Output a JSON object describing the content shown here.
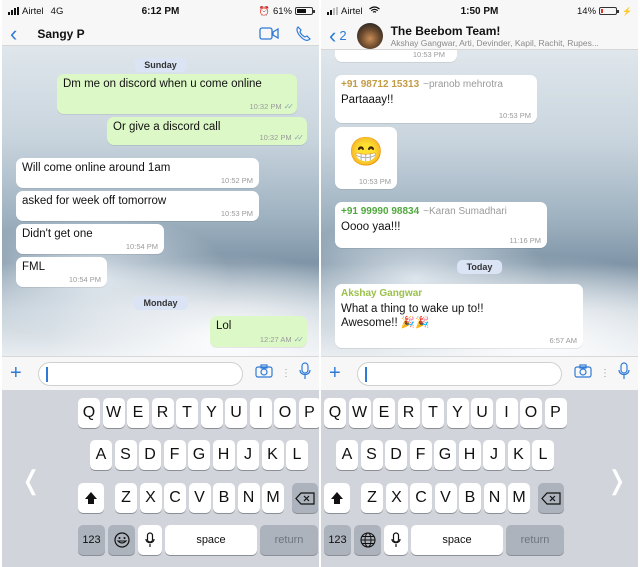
{
  "left": {
    "status": {
      "carrier": "Airtel",
      "network": "4G",
      "time": "6:12 PM",
      "battery": "61%",
      "battery_level": 0.61,
      "alarm_icon": "alarm-icon"
    },
    "header": {
      "back_icon": "chevron-left-icon",
      "title": "Sangy P",
      "video_icon": "video-call-icon",
      "phone_icon": "phone-icon"
    },
    "dates": [
      "Sunday",
      "Monday"
    ],
    "messages": [
      {
        "dir": "out",
        "text": "Dm me on discord when u come online",
        "time": "10:32 PM",
        "ticks": "✓✓"
      },
      {
        "dir": "out",
        "text": "Or give a discord call",
        "time": "10:32 PM",
        "ticks": "✓✓"
      },
      {
        "dir": "in",
        "text": "Will come online around 1am",
        "time": "10:52 PM"
      },
      {
        "dir": "in",
        "text": "asked for week off tomorrow",
        "time": "10:53 PM"
      },
      {
        "dir": "in",
        "text": "Didn't get one",
        "time": "10:54 PM"
      },
      {
        "dir": "in",
        "text": "FML",
        "time": "10:54 PM"
      },
      {
        "dir": "out",
        "text": "Lol",
        "time": "12:27 AM",
        "ticks": "✓✓"
      }
    ],
    "input": {
      "placeholder": "",
      "value": ""
    },
    "keyboard": {
      "row1": [
        "Q",
        "W",
        "E",
        "R",
        "T",
        "Y",
        "U",
        "I",
        "O",
        "P"
      ],
      "row2": [
        "A",
        "S",
        "D",
        "F",
        "G",
        "H",
        "J",
        "K",
        "L"
      ],
      "row3": [
        "Z",
        "X",
        "C",
        "V",
        "B",
        "N",
        "M"
      ],
      "numbers": "123",
      "space": "space",
      "return": "return",
      "extra_icon": "emoji-icon"
    },
    "side_arrow": "❬"
  },
  "right": {
    "status": {
      "carrier": "Airtel",
      "network": "wifi",
      "time": "1:50 PM",
      "battery": "14%",
      "battery_level": 0.14,
      "charging": true
    },
    "header": {
      "back_icon": "chevron-left-icon",
      "back_count": "2",
      "title": "The Beebom Team!",
      "subtitle": "Akshay Gangwar, Arti, Devinder, Kapil, Rachit, Rupes..."
    },
    "dates": [
      "Today"
    ],
    "messages": [
      {
        "dir": "in",
        "time": "10:53 PM",
        "text": ""
      },
      {
        "dir": "in",
        "sender": "+91 98712 15313",
        "alias": "~pranob mehrotra",
        "sender_color": "#c29b45",
        "text": "Partaaay!!",
        "time": "10:53 PM"
      },
      {
        "dir": "in",
        "text": "😁",
        "time": "10:53 PM"
      },
      {
        "dir": "in",
        "sender": "+91 99990 98834",
        "alias": "~Karan Sumadhari",
        "sender_color": "#4fa83d",
        "text": "Oooo yaa!!!",
        "time": "11:16 PM"
      },
      {
        "dir": "in",
        "sender": "Akshay Gangwar",
        "sender_color": "#9bc14a",
        "text": "What a thing to wake up to!! Awesome!! 🎉🎉",
        "time": "6:57 AM"
      }
    ],
    "input": {
      "placeholder": "",
      "value": ""
    },
    "keyboard": {
      "row1": [
        "Q",
        "W",
        "E",
        "R",
        "T",
        "Y",
        "U",
        "I",
        "O",
        "P"
      ],
      "row2": [
        "A",
        "S",
        "D",
        "F",
        "G",
        "H",
        "J",
        "K",
        "L"
      ],
      "row3": [
        "Z",
        "X",
        "C",
        "V",
        "B",
        "N",
        "M"
      ],
      "numbers": "123",
      "space": "space",
      "return": "return",
      "extra_icon": "globe-icon"
    },
    "side_arrow": "❭"
  }
}
